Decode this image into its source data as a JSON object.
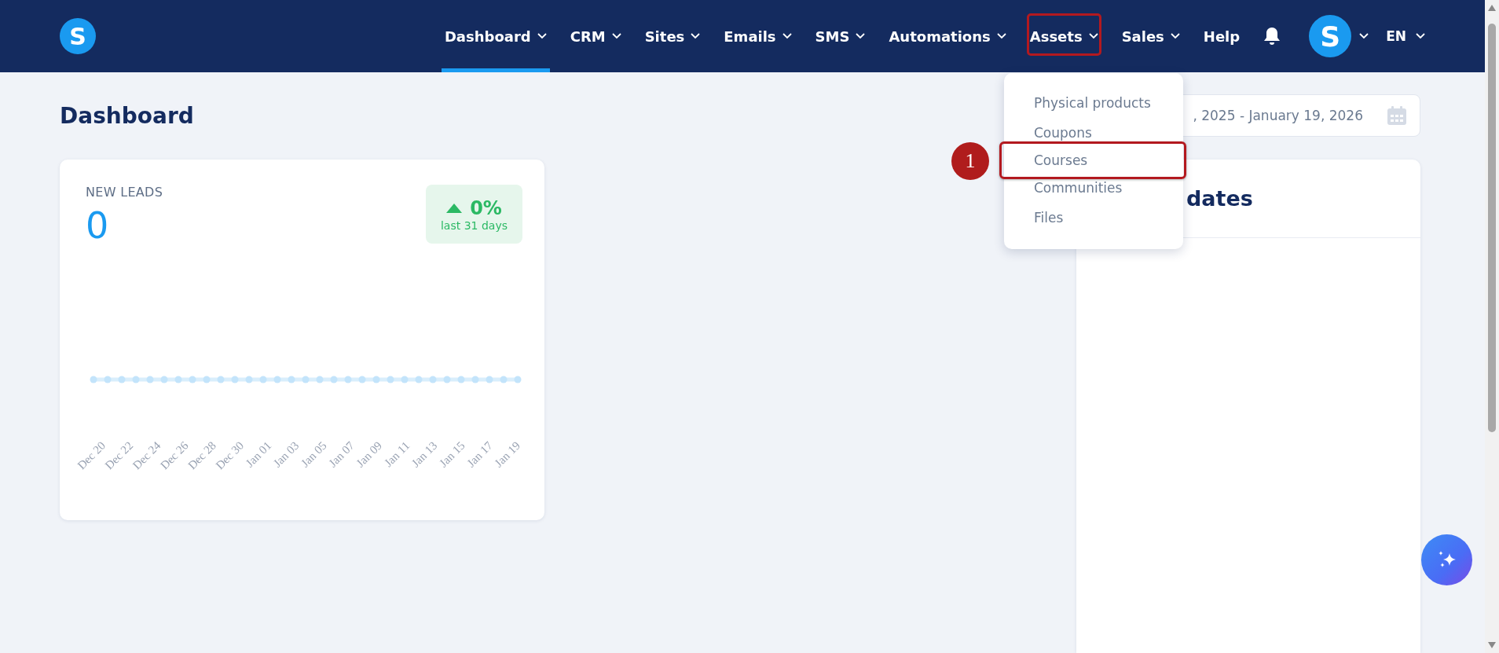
{
  "logo": "S",
  "nav": {
    "items": [
      {
        "label": "Dashboard",
        "selected": true,
        "dropdown": true,
        "outlined": false
      },
      {
        "label": "CRM",
        "selected": false,
        "dropdown": true,
        "outlined": false
      },
      {
        "label": "Sites",
        "selected": false,
        "dropdown": true,
        "outlined": false
      },
      {
        "label": "Emails",
        "selected": false,
        "dropdown": true,
        "outlined": false
      },
      {
        "label": "SMS",
        "selected": false,
        "dropdown": true,
        "outlined": false
      },
      {
        "label": "Automations",
        "selected": false,
        "dropdown": true,
        "outlined": false
      },
      {
        "label": "Assets",
        "selected": false,
        "dropdown": true,
        "outlined": true
      },
      {
        "label": "Sales",
        "selected": false,
        "dropdown": true,
        "outlined": false
      },
      {
        "label": "Help",
        "selected": false,
        "dropdown": false,
        "outlined": false
      }
    ],
    "avatar": "S",
    "language": "EN"
  },
  "page_title": "Dashboard",
  "date_range": ", 2025 - January 19, 2026",
  "assets_menu": {
    "items": [
      {
        "label": "Physical products",
        "outlined": false
      },
      {
        "label": "Coupons",
        "outlined": false
      },
      {
        "label": "Courses",
        "outlined": true
      },
      {
        "label": "Communities",
        "outlined": false
      },
      {
        "label": "Files",
        "outlined": false
      }
    ]
  },
  "step_marker": "1",
  "new_leads": {
    "title": "NEW LEADS",
    "value": "0",
    "change": "0%",
    "period": "last 31 days",
    "x_labels": [
      "Dec 20",
      "Dec 22",
      "Dec 24",
      "Dec 26",
      "Dec 28",
      "Dec 30",
      "Jan 01",
      "Jan 03",
      "Jan 05",
      "Jan 07",
      "Jan 09",
      "Jan 11",
      "Jan 13",
      "Jan 15",
      "Jan 17",
      "Jan 19"
    ]
  },
  "updates_card": {
    "title": "dates"
  }
}
